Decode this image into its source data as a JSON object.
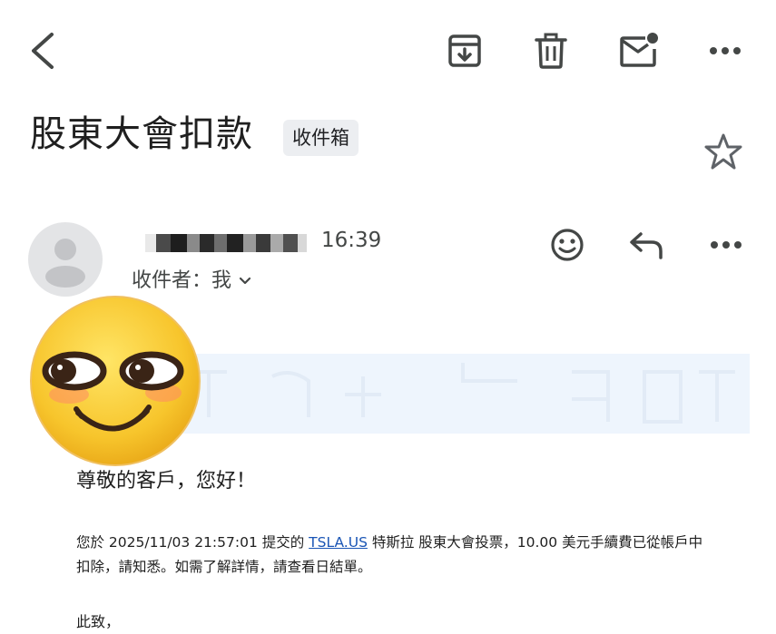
{
  "toolbar": {
    "back_icon": "arrow-back-icon",
    "archive_icon": "archive-icon",
    "delete_icon": "trash-icon",
    "mark_unread_icon": "mark-unread-icon",
    "more_icon": "more-horizontal-icon"
  },
  "email": {
    "subject": "股東大會扣款",
    "label": "收件箱",
    "star_icon": "star-outline-icon",
    "sender": {
      "avatar_icon": "person-icon",
      "time": "16:39",
      "recipient_label": "收件者：我",
      "expand_icon": "chevron-down-icon"
    },
    "actions": {
      "react_icon": "smiley-icon",
      "reply_icon": "reply-icon",
      "more_icon": "more-horizontal-icon"
    },
    "sticker_icon": "smirk-emoji-sticker",
    "body": {
      "greeting": "尊敬的客戶，您好！",
      "para_before_link": "您於 2025/11/03 21:57:01 提交的 ",
      "link_text": "TSLA.US",
      "para_after_link": " 特斯拉 股東大會投票，10.00 美元手續費已從帳戶中扣除，請知悉。如需了解詳情，請查看日結單。",
      "closing": "此致，"
    }
  },
  "colors": {
    "text": "#1f1f1f",
    "icon": "#444746",
    "chip_bg": "#eceef1",
    "link": "#1a55b5",
    "banner_bg": "#eef5fd"
  }
}
